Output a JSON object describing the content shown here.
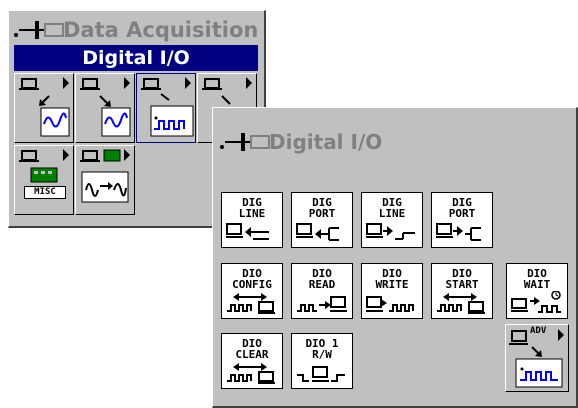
{
  "back_palette": {
    "title": "Data Acquisition",
    "subtitle": "Digital I/O",
    "misc_label": "MISC",
    "icons": [
      "pin-plug-icon",
      "analog-input-icon",
      "analog-output-icon",
      "digital-io-icon",
      "counter-icon",
      "calibration-config-icon",
      "signal-conditioning-icon"
    ]
  },
  "front_palette": {
    "title": "Digital I/O",
    "tiles": {
      "dig_line_read": "DIG\nLINE",
      "dig_port_read": "DIG\nPORT",
      "dig_line_write": "DIG\nLINE",
      "dig_port_write": "DIG\nPORT",
      "dio_config": "DIO\nCONFIG",
      "dio_read": "DIO\nREAD",
      "dio_write": "DIO\nWRITE",
      "dio_start": "DIO\nSTART",
      "dio_wait": "DIO\nWAIT",
      "dio_clear": "DIO\nCLEAR",
      "dio_single_rw": "DIO 1\nR/W",
      "advanced": "ADV"
    }
  },
  "colors": {
    "palette_gray": "#c0c0c0",
    "title_gray": "#808080",
    "subtitle_blue": "#000080",
    "waveform_blue": "#0000ff",
    "board_green": "#008000"
  }
}
